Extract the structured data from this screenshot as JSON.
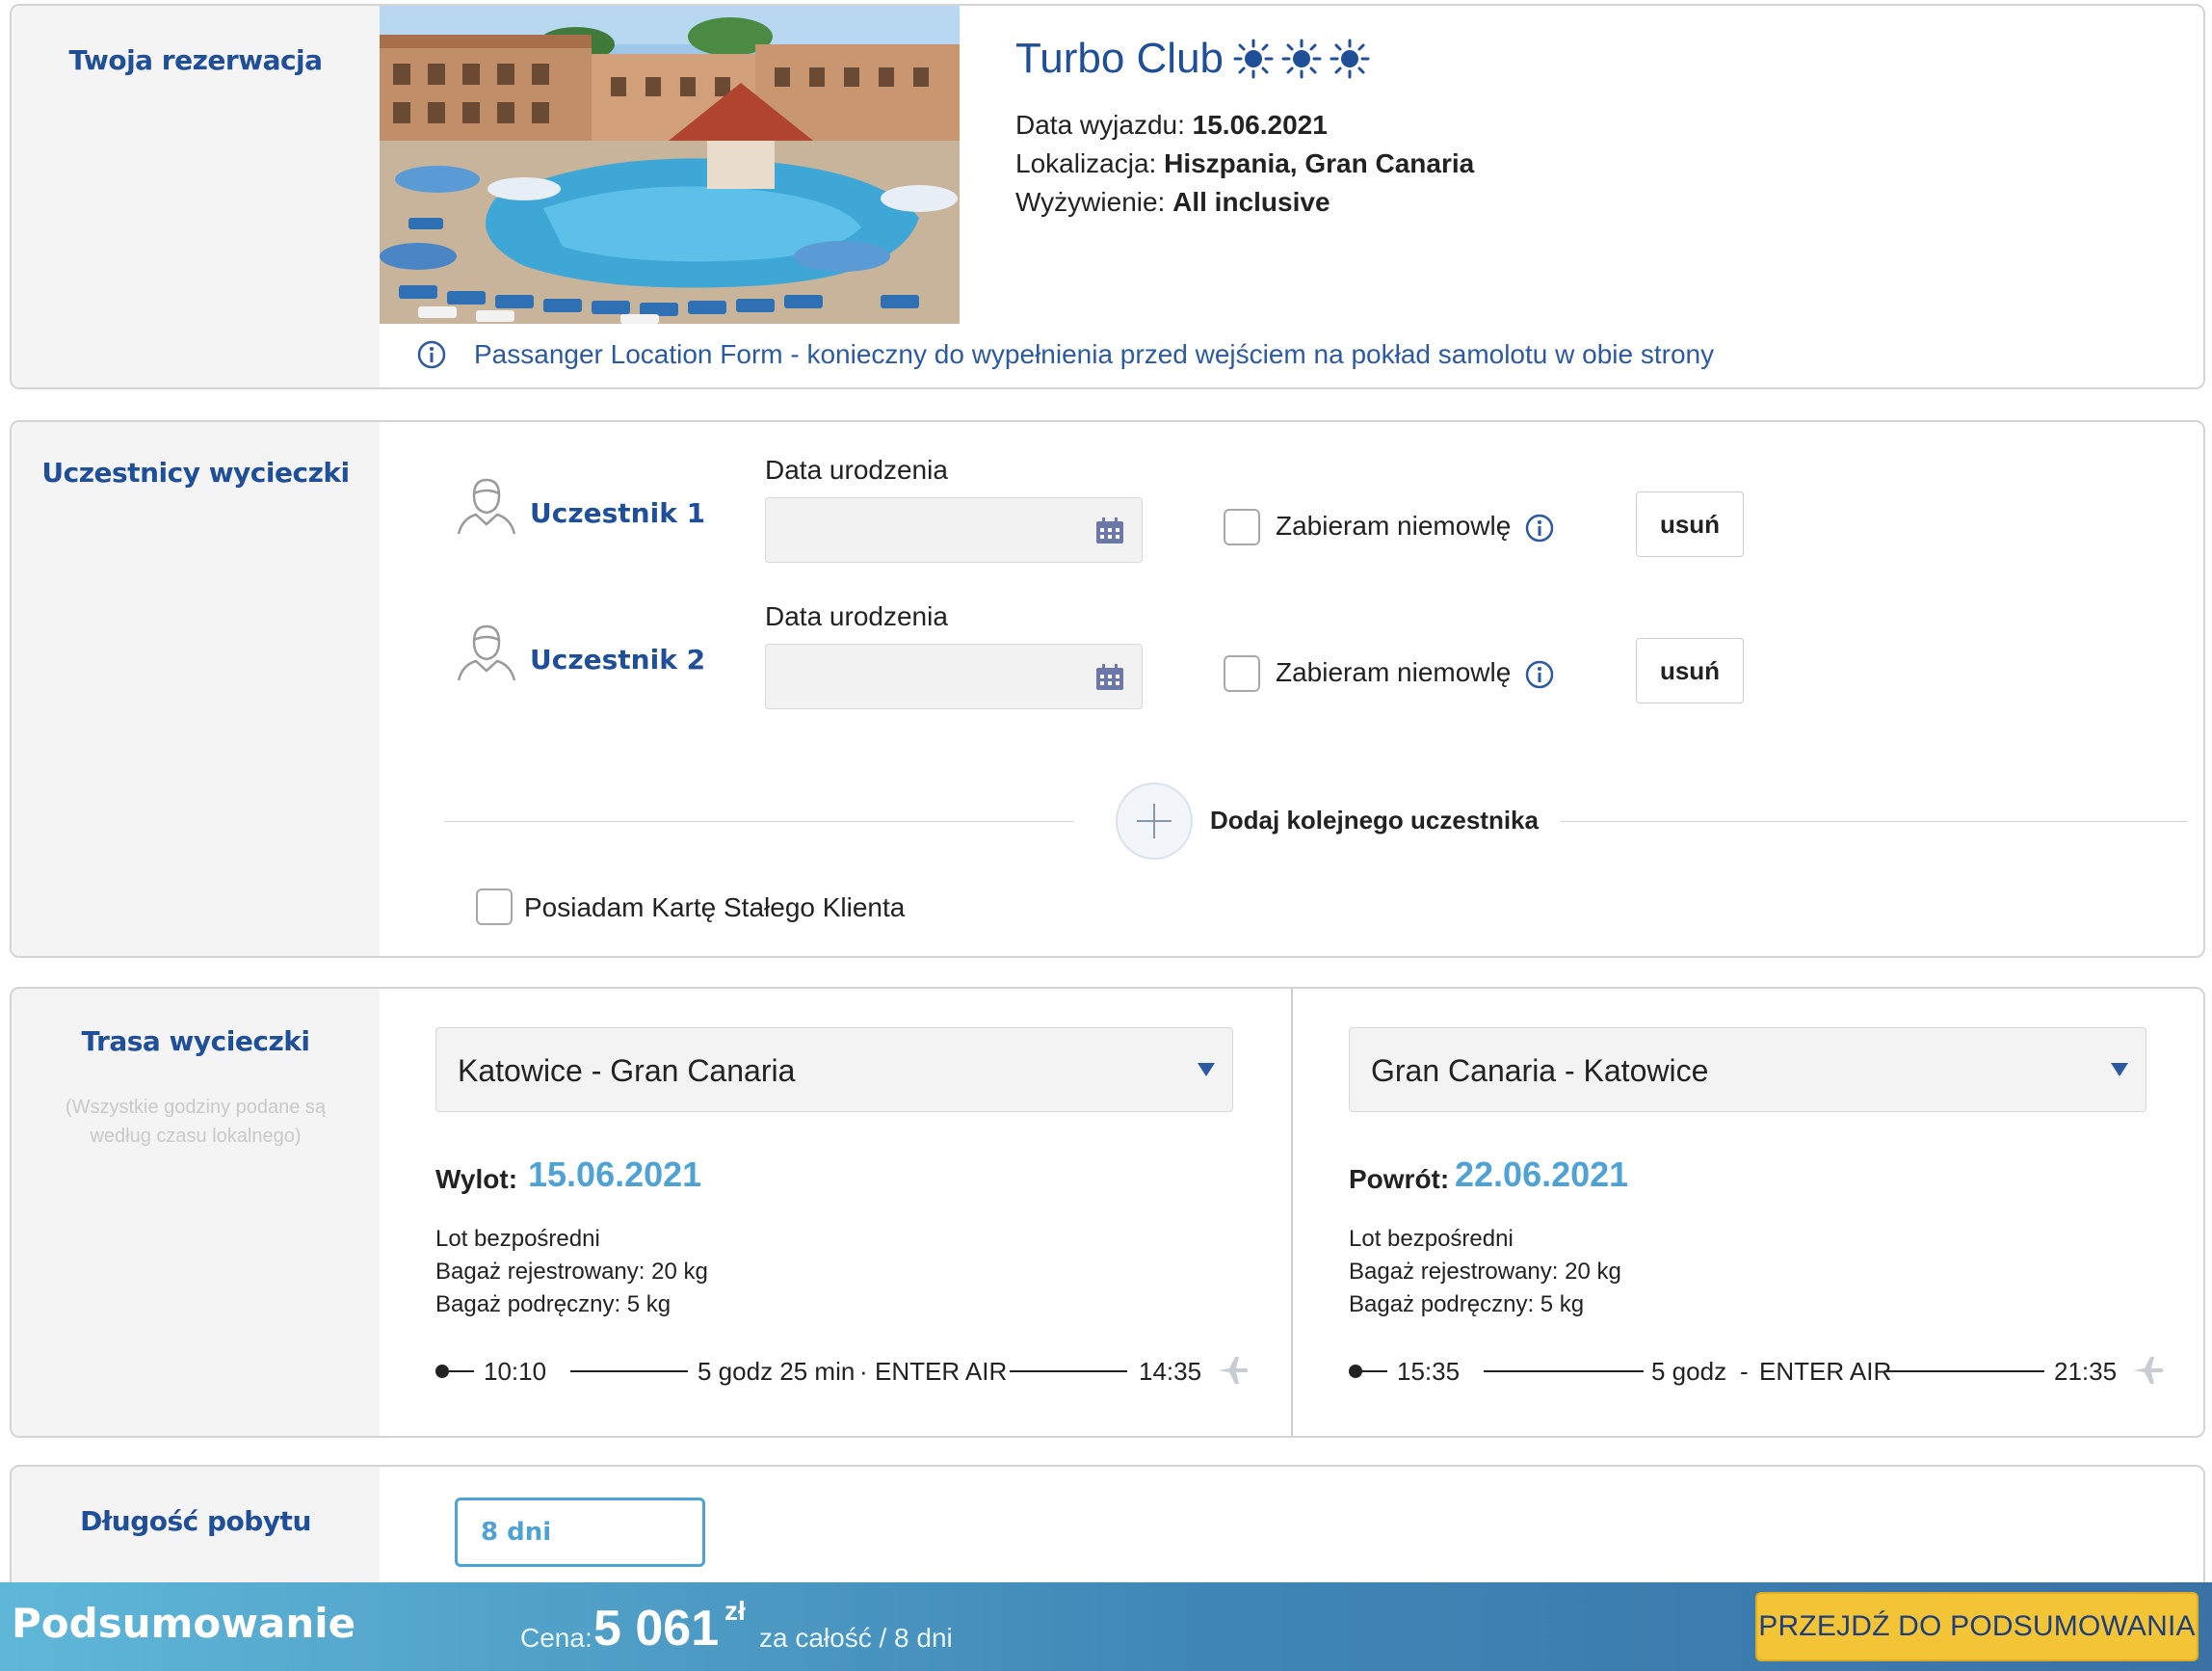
{
  "reservation": {
    "section_title": "Twoja rezerwacja",
    "hotel_name": "Turbo Club",
    "rating_icon": "sun-icon",
    "rating": 3,
    "departure_label": "Data wyjazdu:",
    "departure_value": "15.06.2021",
    "location_label": "Lokalizacja:",
    "location_value": "Hiszpania, Gran Canaria",
    "board_label": "Wyżywienie:",
    "board_value": "All inclusive",
    "plf_text": "Passanger Location Form - konieczny do wypełnienia przed wejściem na pokład samolotu w obie strony"
  },
  "participants": {
    "section_title": "Uczestnicy wycieczki",
    "items": [
      {
        "name": "Uczestnik 1",
        "dob_label": "Data urodzenia",
        "dob_value": "",
        "infant_label": "Zabieram niemowlę",
        "infant_checked": false,
        "remove_label": "usuń"
      },
      {
        "name": "Uczestnik 2",
        "dob_label": "Data urodzenia",
        "dob_value": "",
        "infant_label": "Zabieram niemowlę",
        "infant_checked": false,
        "remove_label": "usuń"
      }
    ],
    "add_label": "Dodaj kolejnego uczestnika",
    "loyalty_label": "Posiadam Kartę Stałego Klienta",
    "loyalty_checked": false
  },
  "route": {
    "section_title": "Trasa wycieczki",
    "note": "(Wszystkie godziny podane są według czasu lokalnego)",
    "outbound": {
      "select_value": "Katowice - Gran Canaria",
      "date_label": "Wylot:",
      "date_value": "15.06.2021",
      "flight_type": "Lot bezpośredni",
      "checked_baggage": "Bagaż rejestrowany: 20 kg",
      "hand_baggage": "Bagaż podręczny: 5 kg",
      "depart_time": "10:10",
      "duration": "5 godz 25 min",
      "sep": "·",
      "airline": "ENTER AIR",
      "arrive_time": "14:35"
    },
    "return": {
      "select_value": "Gran Canaria - Katowice",
      "date_label": "Powrót:",
      "date_value": "22.06.2021",
      "flight_type": "Lot bezpośredni",
      "checked_baggage": "Bagaż rejestrowany: 20 kg",
      "hand_baggage": "Bagaż podręczny: 5 kg",
      "depart_time": "15:35",
      "duration": "5 godz",
      "sep": "-",
      "airline": "ENTER AIR",
      "arrive_time": "21:35"
    }
  },
  "stay": {
    "section_title": "Długość pobytu",
    "value": "8 dni"
  },
  "summary": {
    "title": "Podsumowanie",
    "price_label": "Cena:",
    "price_value": "5 061",
    "currency": "zł",
    "price_suffix": "za całość / 8 dni",
    "cta_label": "PRZEJDŹ DO PODSUMOWANIA"
  },
  "colors": {
    "brand_blue": "#1f4f98",
    "accent_blue": "#4fa3d4",
    "cta_yellow": "#f3c536"
  }
}
